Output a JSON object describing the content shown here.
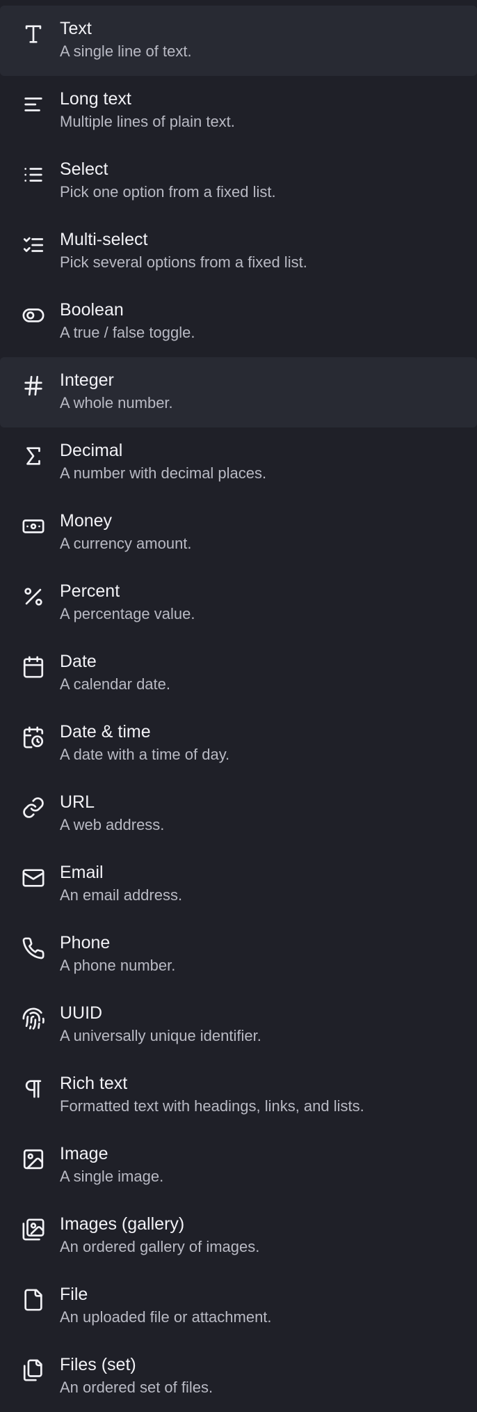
{
  "field_types": [
    {
      "label": "Text",
      "description": "A single line of text.",
      "icon": "type-icon"
    },
    {
      "label": "Long text",
      "description": "Multiple lines of plain text.",
      "icon": "align-left-icon"
    },
    {
      "label": "Select",
      "description": "Pick one option from a fixed list.",
      "icon": "list-icon"
    },
    {
      "label": "Multi-select",
      "description": "Pick several options from a fixed list.",
      "icon": "list-checks-icon"
    },
    {
      "label": "Boolean",
      "description": "A true / false toggle.",
      "icon": "toggle-icon"
    },
    {
      "label": "Integer",
      "description": "A whole number.",
      "icon": "hash-icon"
    },
    {
      "label": "Decimal",
      "description": "A number with decimal places.",
      "icon": "sigma-icon"
    },
    {
      "label": "Money",
      "description": "A currency amount.",
      "icon": "banknote-icon"
    },
    {
      "label": "Percent",
      "description": "A percentage value.",
      "icon": "percent-icon"
    },
    {
      "label": "Date",
      "description": "A calendar date.",
      "icon": "calendar-icon"
    },
    {
      "label": "Date & time",
      "description": "A date with a time of day.",
      "icon": "calendar-clock-icon"
    },
    {
      "label": "URL",
      "description": "A web address.",
      "icon": "link-icon"
    },
    {
      "label": "Email",
      "description": "An email address.",
      "icon": "mail-icon"
    },
    {
      "label": "Phone",
      "description": "A phone number.",
      "icon": "phone-icon"
    },
    {
      "label": "UUID",
      "description": "A universally unique identifier.",
      "icon": "fingerprint-icon"
    },
    {
      "label": "Rich text",
      "description": "Formatted text with headings, links, and lists.",
      "icon": "pilcrow-icon"
    },
    {
      "label": "Image",
      "description": "A single image.",
      "icon": "image-icon"
    },
    {
      "label": "Images (gallery)",
      "description": "An ordered gallery of images.",
      "icon": "images-icon"
    },
    {
      "label": "File",
      "description": "An uploaded file or attachment.",
      "icon": "file-icon"
    },
    {
      "label": "Files (set)",
      "description": "An ordered set of files.",
      "icon": "files-icon"
    }
  ],
  "highlighted_index": 0,
  "hovered_index": 5,
  "colors": {
    "background": "#1f2028",
    "highlight": "#282a33",
    "text": "#f2f2f6",
    "muted_text": "#b9bac4"
  }
}
